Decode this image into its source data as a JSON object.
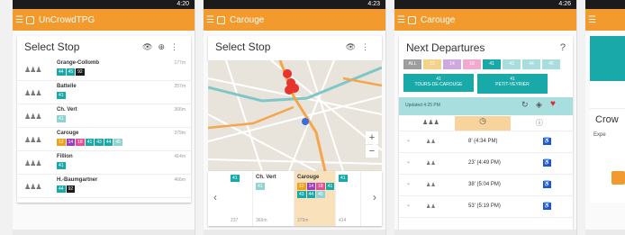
{
  "colors": {
    "orange": "#f29a2e",
    "teal": "#19a9a8",
    "status": "#1b1b1b",
    "access_blue": "#1e55c7"
  },
  "screen1": {
    "time": "4:20",
    "app_title": "UnCrowdTPG",
    "card_title": "Select Stop",
    "stops": [
      {
        "name": "Grange-Collomb",
        "dist": "177m",
        "badges": [
          {
            "t": "44",
            "c": "#19a9a8"
          },
          {
            "t": "45",
            "c": "#19a9a8"
          },
          {
            "t": "92",
            "c": "#1a1a1a"
          }
        ]
      },
      {
        "name": "Battelle",
        "dist": "257m",
        "badges": [
          {
            "t": "41",
            "c": "#19a9a8"
          }
        ]
      },
      {
        "name": "Ch. Vert",
        "dist": "366m",
        "badges": [
          {
            "t": "41",
            "c": "#8fd3d1"
          }
        ]
      },
      {
        "name": "Carouge",
        "dist": "379m",
        "badges": [
          {
            "t": "12",
            "c": "#f0a11a"
          },
          {
            "t": "14",
            "c": "#9b3cc2"
          },
          {
            "t": "18",
            "c": "#e0509a"
          },
          {
            "t": "41",
            "c": "#19a9a8"
          },
          {
            "t": "43",
            "c": "#19a9a8"
          },
          {
            "t": "44",
            "c": "#19a9a8"
          },
          {
            "t": "45",
            "c": "#8fd3d1"
          }
        ]
      },
      {
        "name": "Fillion",
        "dist": "414m",
        "badges": [
          {
            "t": "41",
            "c": "#19a9a8"
          }
        ]
      },
      {
        "name": "H.-Baumgartner",
        "dist": "466m",
        "badges": [
          {
            "t": "44",
            "c": "#19a9a8"
          },
          {
            "t": "92",
            "c": "#1a1a1a"
          }
        ]
      }
    ]
  },
  "screen2": {
    "time": "4:23",
    "app_title": "Carouge",
    "card_title": "Select Stop",
    "zoom_in": "+",
    "zoom_out": "−",
    "strip": [
      {
        "name": "",
        "dist": "237",
        "badges": [
          {
            "t": "41",
            "c": "#19a9a8"
          }
        ]
      },
      {
        "name": "Ch. Vert",
        "dist": "366m",
        "badges": [
          {
            "t": "41",
            "c": "#8fd3d1"
          }
        ]
      },
      {
        "name": "Carouge",
        "dist": "379m",
        "badges": [
          {
            "t": "12",
            "c": "#f0a11a"
          },
          {
            "t": "14",
            "c": "#9b3cc2"
          },
          {
            "t": "18",
            "c": "#e0509a"
          },
          {
            "t": "41",
            "c": "#19a9a8"
          },
          {
            "t": "43",
            "c": "#19a9a8"
          },
          {
            "t": "44",
            "c": "#19a9a8"
          },
          {
            "t": "45",
            "c": "#8fd3d1"
          }
        ]
      },
      {
        "name": "",
        "dist": "414",
        "badges": [
          {
            "t": "41",
            "c": "#19a9a8"
          }
        ]
      }
    ]
  },
  "screen3": {
    "time": "4:26",
    "app_title": "Carouge",
    "card_title": "Next Departures",
    "help": "?",
    "filters": [
      {
        "t": "ALL",
        "c": "#9e9e9e"
      },
      {
        "t": "12",
        "c": "#f5d28a"
      },
      {
        "t": "14",
        "c": "#cfa8e0"
      },
      {
        "t": "18",
        "c": "#f2a9cf"
      },
      {
        "t": "41",
        "c": "#19a9a8"
      },
      {
        "t": "43",
        "c": "#a8dedd"
      },
      {
        "t": "44",
        "c": "#a8dedd"
      },
      {
        "t": "45",
        "c": "#a8dedd"
      }
    ],
    "directions": [
      {
        "line": "41",
        "dest": "TOURS-DE-CAROUGE"
      },
      {
        "line": "41",
        "dest": "PETIT-VEYRIER"
      }
    ],
    "updated": "Updated 4:25 PM",
    "departures": [
      {
        "time": "8' (4:34 PM)"
      },
      {
        "time": "23' (4:49 PM)"
      },
      {
        "time": "38' (5:04 PM)"
      },
      {
        "time": "53' (5:19 PM)"
      }
    ]
  },
  "screen4": {
    "title": "Crow",
    "sub": "Expe"
  }
}
